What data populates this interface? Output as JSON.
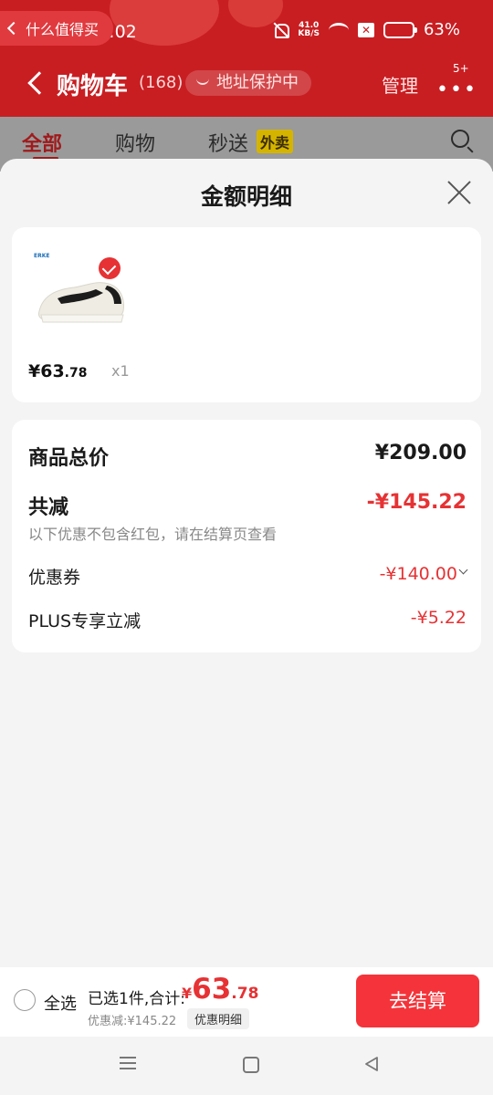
{
  "status_bar": {
    "back_app": "什么值得买",
    "time": "22:02",
    "net_speed_value": "41.0",
    "net_speed_unit": "KB/S",
    "battery": "63%"
  },
  "cart_header": {
    "title": "购物车",
    "count": "(168)",
    "address_protection": "地址保护中",
    "manage": "管理",
    "more_badge": "5+"
  },
  "tabs": [
    {
      "label": "全部",
      "active": true
    },
    {
      "label": "购物",
      "active": false
    },
    {
      "label": "秒送",
      "active": false
    }
  ],
  "tab_tag": "外卖",
  "sheet": {
    "title": "金额明细"
  },
  "product": {
    "brand": "ERKE",
    "price_int": "¥63",
    "price_dec": ".78",
    "quantity": "x1",
    "selected": true
  },
  "details": {
    "total_label": "商品总价",
    "total_value": "¥209.00",
    "reduce_label": "共减",
    "reduce_value": "-¥145.22",
    "note": "以下优惠不包含红包，请在结算页查看",
    "coupon_label": "优惠券",
    "coupon_value": "-¥140.00",
    "plus_label": "PLUS专享立减",
    "plus_value": "-¥5.22"
  },
  "bottom_bar": {
    "select_all": "全选",
    "summary": "已选1件,合计:",
    "price_yen": "¥",
    "price_int": "63",
    "price_dec": ".78",
    "discount": "优惠减:¥145.22",
    "detail_button": "优惠明细",
    "checkout": "去结算"
  },
  "colors": {
    "brand_red": "#c81e22",
    "accent_red": "#e63234",
    "checkout_red": "#f4343a"
  }
}
